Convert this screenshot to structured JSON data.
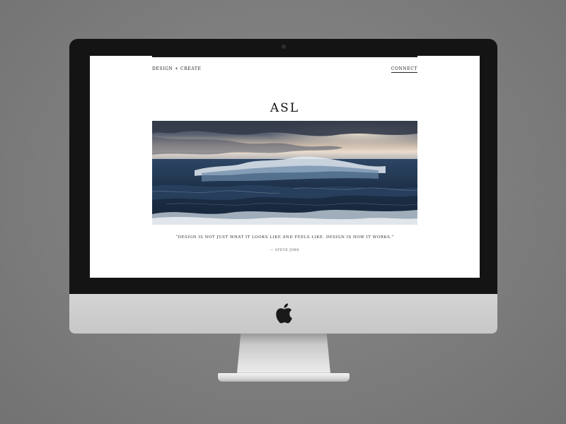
{
  "site": {
    "nav_left": "DESIGN + CREATE",
    "nav_right": "CONNECT",
    "logo": "ASL",
    "hero_image": "stormy-ocean-waves",
    "quote": "“DESIGN IS NOT JUST WHAT IT LOOKS LIKE AND FEELS LIKE. DESIGN IS HOW IT WORKS.”",
    "attribution": "— STEVE JOBS"
  },
  "device": {
    "type": "imac",
    "logo_icon": "apple-icon",
    "bezel_color": "#141414",
    "chin_color": "#cbcbcb",
    "background_color": "#7f7f7f"
  }
}
